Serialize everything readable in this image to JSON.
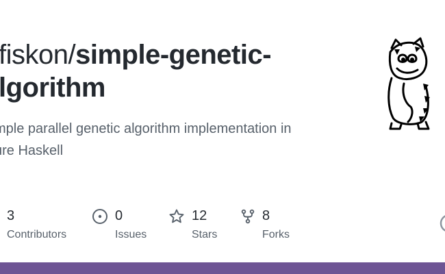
{
  "repo": {
    "owner_visible": "fiskon/",
    "name_line1": "simple-genetic-",
    "name_line2": "lgorithm",
    "description_line1": "mple parallel genetic algorithm implementation in",
    "description_line2": "ure Haskell"
  },
  "stats": {
    "contributors": {
      "value": "3",
      "label": "Contributors"
    },
    "issues": {
      "value": "0",
      "label": "Issues",
      "icon": "issue-circle-icon"
    },
    "stars": {
      "value": "12",
      "label": "Stars",
      "icon": "star-icon"
    },
    "forks": {
      "value": "8",
      "label": "Forks",
      "icon": "fork-icon"
    }
  },
  "colors": {
    "text_primary": "#24292f",
    "text_secondary": "#57606a",
    "bottom_bar": "#6e5494"
  }
}
